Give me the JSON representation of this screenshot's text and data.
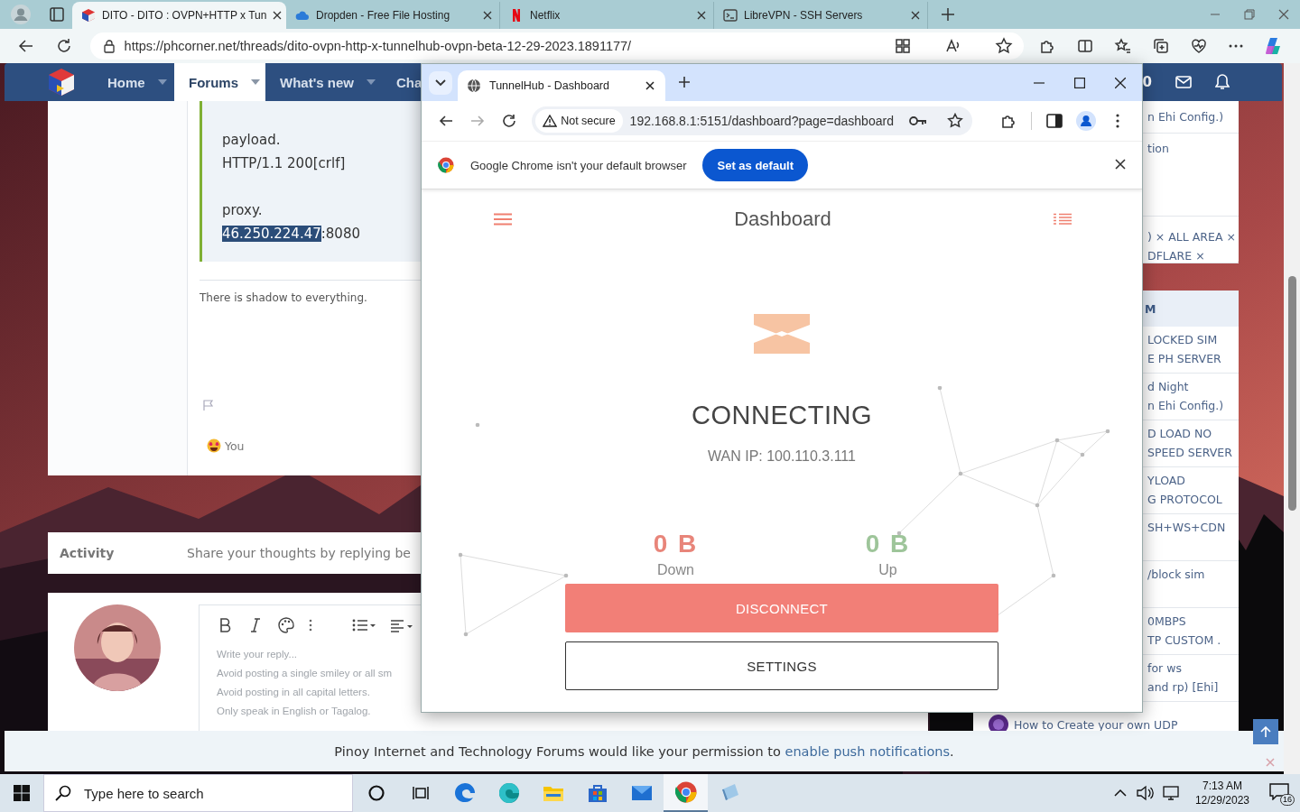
{
  "edge": {
    "tabs": [
      {
        "title": "DITO - DITO : OVPN+HTTP x Tun",
        "kind": "forum",
        "selected": true
      },
      {
        "title": "Dropden - Free File Hosting",
        "kind": "cloud",
        "selected": false
      },
      {
        "title": "Netflix",
        "kind": "netflix",
        "selected": false
      },
      {
        "title": "LibreVPN - SSH Servers",
        "kind": "terminal",
        "selected": false
      }
    ],
    "url": "https://phcorner.net/threads/dito-ovpn-http-x-tunnelhub-ovpn-beta-12-29-2023.1891177/"
  },
  "forum": {
    "nav": [
      {
        "label": "Home",
        "selected": false
      },
      {
        "label": "Forums",
        "selected": true
      },
      {
        "label": "What's new",
        "selected": false
      },
      {
        "label": "Cha",
        "selected": false
      }
    ],
    "nav_count": "0",
    "post": {
      "lines": [
        "payload.",
        "HTTP/1.1 200[crlf]"
      ],
      "proxy_label": "proxy.",
      "proxy_selected": "46.250.224.47",
      "proxy_rest": ":8080",
      "signature": "There is shadow to everything.",
      "reaction": "You"
    },
    "activity": {
      "label": "Activity",
      "prompt": "Share your thoughts by replying be"
    },
    "editor": {
      "lines": [
        "Write your reply...",
        "Avoid posting a single smiley or all sm",
        "Avoid posting in all capital letters.",
        "Only speak in English or Tagalog."
      ]
    },
    "sidebar": {
      "card1": [
        {
          "lines": [
            "n Ehi Config.)"
          ]
        },
        {
          "lines": [
            "tion"
          ]
        },
        {
          "lines": [
            ") × ALL AREA ×",
            "DFLARE ×"
          ],
          "kind": "tags"
        }
      ],
      "card2_header": "M",
      "card2": [
        {
          "lines": [
            "LOCKED SIM",
            "E PH SERVER"
          ]
        },
        {
          "lines": [
            "d Night",
            "n Ehi Config.)"
          ]
        },
        {
          "lines": [
            "D LOAD NO",
            "SPEED SERVER"
          ]
        },
        {
          "lines": [
            "YLOAD",
            "G PROTOCOL"
          ]
        },
        {
          "lines": [
            "SH+WS+CDN"
          ]
        },
        {
          "lines": [
            "/block sim"
          ]
        },
        {
          "lines": [
            "0MBPS",
            "TP CUSTOM ."
          ]
        },
        {
          "lines": [
            "for ws",
            "and rp) [Ehi]"
          ]
        }
      ],
      "last_thread": "How to Create your own UDP"
    },
    "push": {
      "text": "Pinoy Internet and Technology Forums would like your permission to",
      "link": "enable push notifications",
      "end": "."
    }
  },
  "chrome": {
    "tab": "TunnelHub - Dashboard",
    "not_secure": "Not secure",
    "url": "192.168.8.1:5151/dashboard?page=dashboard",
    "infobar": {
      "text": "Google Chrome isn't your default browser",
      "button": "Set as default"
    },
    "app": {
      "title": "Dashboard",
      "status": "CONNECTING",
      "wan_ip": "WAN IP: 100.110.3.111",
      "stats": [
        {
          "value": "0 B",
          "label": "Down",
          "kind": "down"
        },
        {
          "value": "0 B",
          "label": "Up",
          "kind": "up"
        }
      ],
      "buttons": [
        {
          "label": "DISCONNECT",
          "kind": "primary"
        },
        {
          "label": "SETTINGS",
          "kind": "outline"
        }
      ]
    }
  },
  "taskbar": {
    "search_placeholder": "Type here to search",
    "apps": [
      {
        "kind": "cortana",
        "selected": false
      },
      {
        "kind": "taskview",
        "selected": false
      },
      {
        "kind": "edge",
        "selected": false
      },
      {
        "kind": "edge-dev",
        "selected": false
      },
      {
        "kind": "files",
        "selected": false
      },
      {
        "kind": "store",
        "selected": false
      },
      {
        "kind": "mail",
        "selected": false
      },
      {
        "kind": "chrome",
        "selected": true
      },
      {
        "kind": "app",
        "selected": false
      }
    ],
    "time": "7:13 AM",
    "date": "12/29/2023",
    "notifications": "16"
  }
}
